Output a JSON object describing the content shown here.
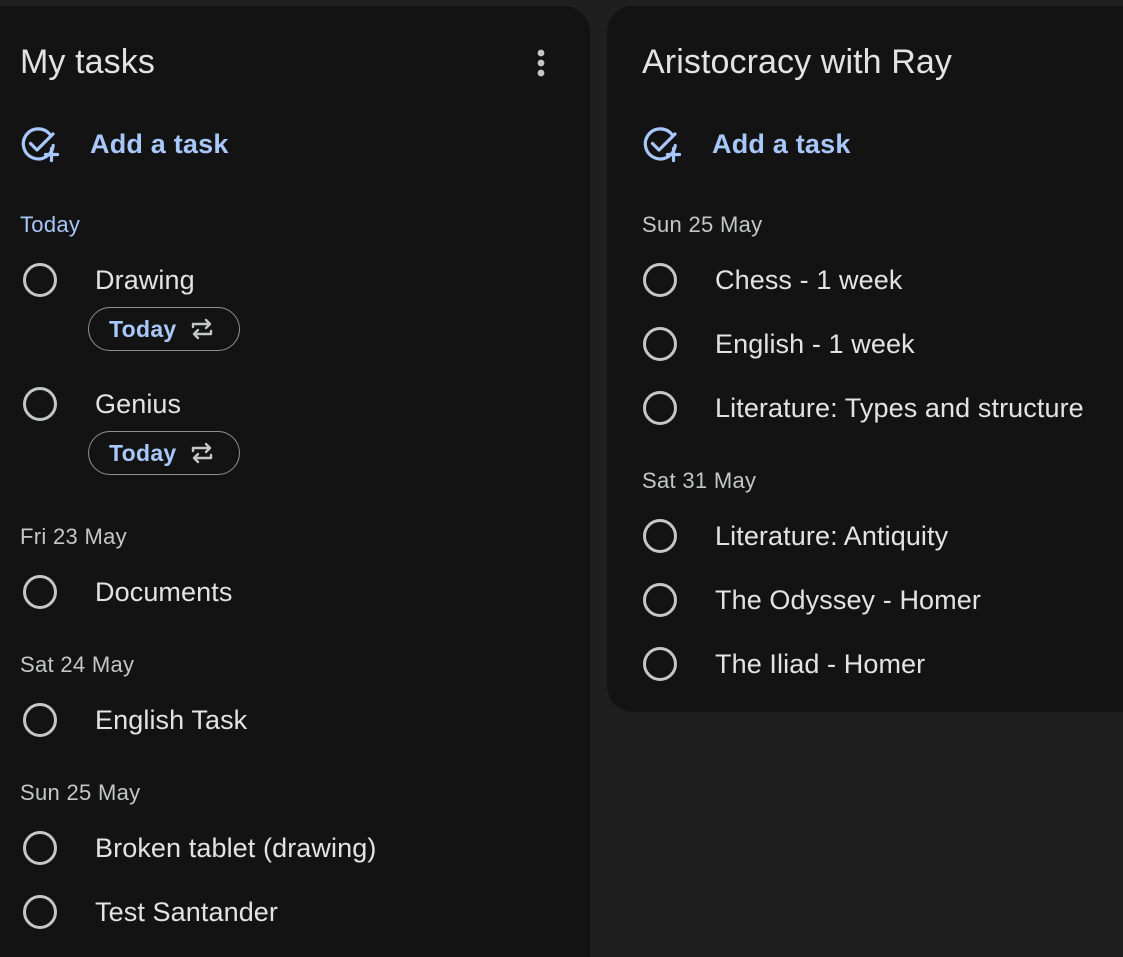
{
  "colors": {
    "background": "#1f1f1f",
    "panel": "#131313",
    "accent": "#a8c7fa",
    "text": "#e3e3e3",
    "muted": "#c4c7c5"
  },
  "left_list": {
    "title": "My tasks",
    "more_icon": "more-vert-icon",
    "add_task_label": "Add a task",
    "add_task_icon": "add-task-icon",
    "sections": [
      {
        "heading": "Today",
        "tasks": [
          {
            "title": "Drawing",
            "chip": "Today",
            "chip_icon": "repeat-icon"
          },
          {
            "title": "Genius",
            "chip": "Today",
            "chip_icon": "repeat-icon"
          }
        ]
      },
      {
        "heading": "Fri 23 May",
        "tasks": [
          {
            "title": "Documents"
          }
        ]
      },
      {
        "heading": "Sat 24 May",
        "tasks": [
          {
            "title": "English Task"
          }
        ]
      },
      {
        "heading": "Sun 25 May",
        "tasks": [
          {
            "title": "Broken tablet (drawing)"
          },
          {
            "title": "Test Santander"
          }
        ]
      }
    ]
  },
  "right_list": {
    "title": "Aristocracy with Ray",
    "add_task_label": "Add a task",
    "add_task_icon": "add-task-icon",
    "sections": [
      {
        "heading": "Sun 25 May",
        "tasks": [
          {
            "title": "Chess - 1 week"
          },
          {
            "title": "English - 1 week"
          },
          {
            "title": "Literature: Types and structure"
          }
        ]
      },
      {
        "heading": "Sat 31 May",
        "tasks": [
          {
            "title": "Literature: Antiquity"
          },
          {
            "title": "The Odyssey - Homer"
          },
          {
            "title": "The Iliad - Homer"
          }
        ]
      }
    ]
  }
}
